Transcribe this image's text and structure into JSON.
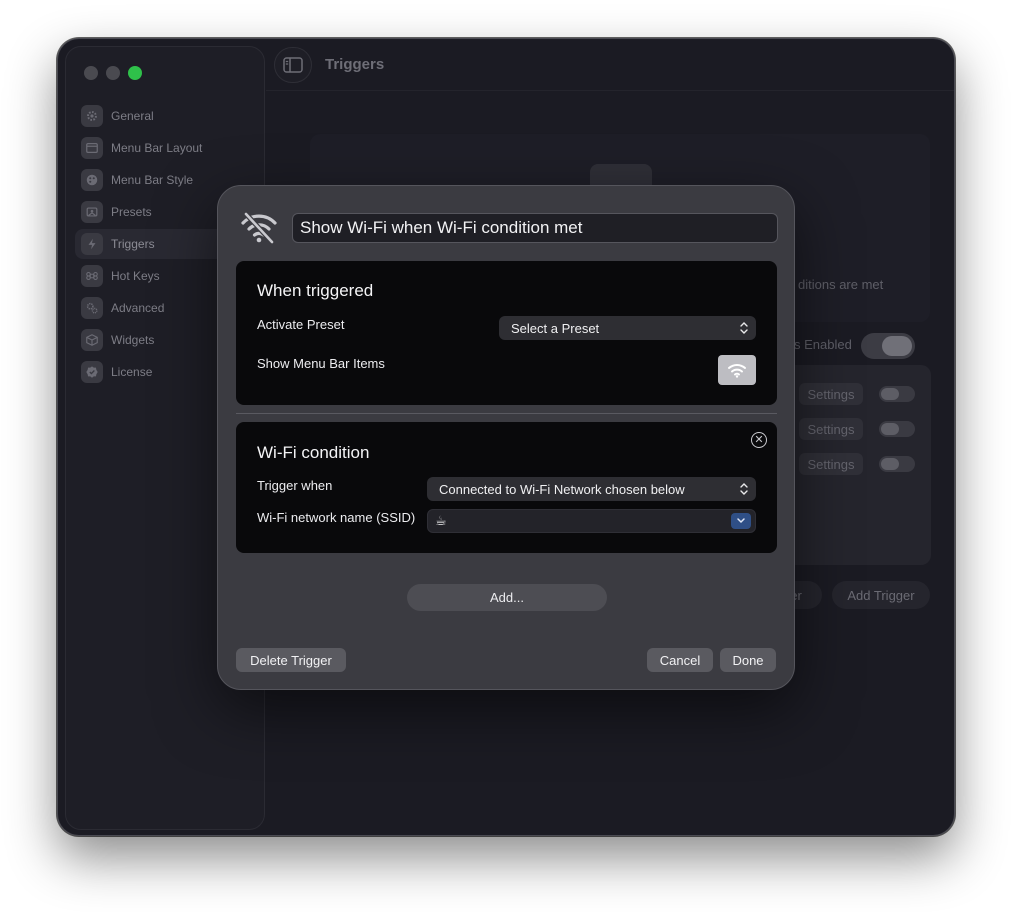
{
  "window": {
    "title": "Triggers",
    "traffic_lights": [
      "close",
      "minimize",
      "zoom"
    ]
  },
  "sidebar": {
    "items": [
      {
        "label": "General",
        "icon": "gear-icon"
      },
      {
        "label": "Menu Bar Layout",
        "icon": "layout-icon"
      },
      {
        "label": "Menu Bar Style",
        "icon": "palette-icon"
      },
      {
        "label": "Presets",
        "icon": "presets-icon"
      },
      {
        "label": "Triggers",
        "icon": "bolt-icon",
        "active": true
      },
      {
        "label": "Hot Keys",
        "icon": "command-icon"
      },
      {
        "label": "Advanced",
        "icon": "gears-icon"
      },
      {
        "label": "Widgets",
        "icon": "cube-icon"
      },
      {
        "label": "License",
        "icon": "badge-check-icon"
      }
    ]
  },
  "background": {
    "conditions_text": "ditions are met",
    "enabled_label": "s Enabled",
    "settings_label": "Settings",
    "partial_button": "er",
    "add_trigger": "Add Trigger"
  },
  "sheet": {
    "trigger_name": "Show Wi-Fi when Wi-Fi condition met",
    "header_icon": "wifi-slash-icon",
    "when_triggered": {
      "title": "When triggered",
      "activate_preset_label": "Activate Preset",
      "preset_select": "Select a Preset",
      "show_items_label": "Show Menu Bar Items",
      "menu_bar_item_icon": "wifi-icon"
    },
    "wifi_condition": {
      "title": "Wi-Fi condition",
      "trigger_when_label": "Trigger when",
      "trigger_when_value": "Connected to Wi-Fi Network chosen below",
      "ssid_label": "Wi-Fi network name (SSID)",
      "ssid_value": "☕"
    },
    "add_button": "Add...",
    "delete_button": "Delete Trigger",
    "cancel_button": "Cancel",
    "done_button": "Done"
  },
  "colors": {
    "window_bg": "#1b1b23",
    "sheet_bg": "#3b3b41",
    "box_bg": "#09090b",
    "traffic_green": "#2fc14a"
  }
}
